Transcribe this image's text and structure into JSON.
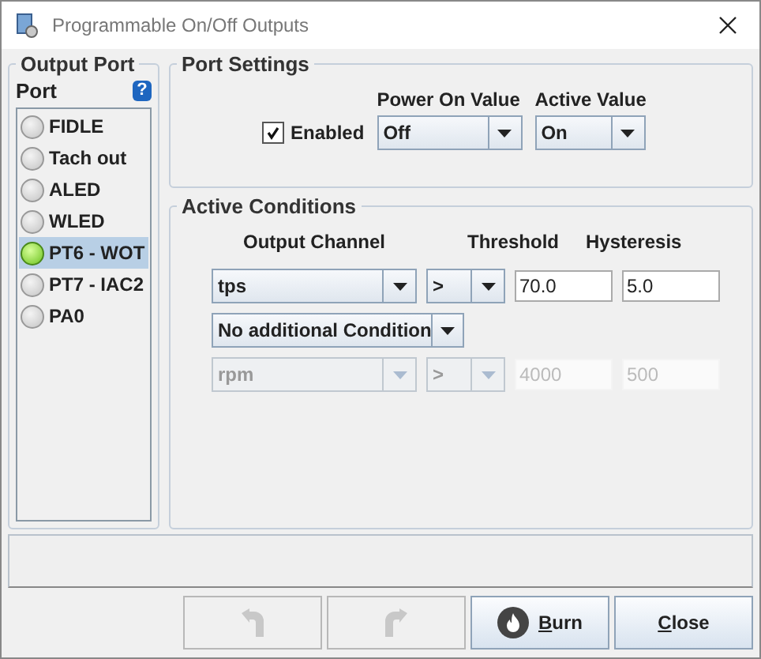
{
  "window": {
    "title": "Programmable On/Off Outputs"
  },
  "output_port": {
    "title": "Output Port",
    "list_label": "Port",
    "help_icon": "?",
    "ports": [
      {
        "label": "FIDLE",
        "on": false,
        "selected": false
      },
      {
        "label": "Tach out",
        "on": false,
        "selected": false
      },
      {
        "label": "ALED",
        "on": false,
        "selected": false
      },
      {
        "label": "WLED",
        "on": false,
        "selected": false
      },
      {
        "label": "PT6 - WOT",
        "on": true,
        "selected": true
      },
      {
        "label": "PT7 - IAC2",
        "on": false,
        "selected": false
      },
      {
        "label": "PA0",
        "on": false,
        "selected": false
      }
    ]
  },
  "port_settings": {
    "title": "Port Settings",
    "enabled": {
      "label": "Enabled",
      "checked": true
    },
    "power_on_value": {
      "label": "Power On Value",
      "value": "Off"
    },
    "active_value": {
      "label": "Active Value",
      "value": "On"
    }
  },
  "active_conditions": {
    "title": "Active Conditions",
    "headers": {
      "channel": "Output Channel",
      "threshold": "Threshold",
      "hysteresis": "Hysteresis"
    },
    "conditions": [
      {
        "channel": "tps",
        "operator": ">",
        "threshold": "70.0",
        "hysteresis": "5.0",
        "disabled": false
      },
      {
        "channel": "rpm",
        "operator": ">",
        "threshold": "4000",
        "hysteresis": "500",
        "disabled": true
      }
    ],
    "combiner": {
      "value": "No additional Condition"
    }
  },
  "buttons": [
    {
      "kind": "undo",
      "disabled": true
    },
    {
      "kind": "redo",
      "disabled": true
    },
    {
      "kind": "burn",
      "label": "Burn",
      "disabled": false
    },
    {
      "kind": "close",
      "label": "Close",
      "disabled": false
    }
  ]
}
